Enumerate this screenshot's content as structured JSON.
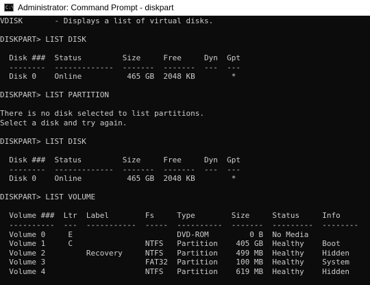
{
  "window": {
    "title": "Administrator: Command Prompt - diskpart",
    "icon_glyph": "C:\\"
  },
  "console": {
    "lines": [
      "VDISK       - Displays a list of virtual disks.",
      "",
      "DISKPART> LIST DISK",
      "",
      "  Disk ###  Status         Size     Free     Dyn  Gpt",
      "  --------  -------------  -------  -------  ---  ---",
      "  Disk 0    Online          465 GB  2048 KB        *",
      "",
      "DISKPART> LIST PARTITION",
      "",
      "There is no disk selected to list partitions.",
      "Select a disk and try again.",
      "",
      "DISKPART> LIST DISK",
      "",
      "  Disk ###  Status         Size     Free     Dyn  Gpt",
      "  --------  -------------  -------  -------  ---  ---",
      "  Disk 0    Online          465 GB  2048 KB        *",
      "",
      "DISKPART> LIST VOLUME",
      "",
      "  Volume ###  Ltr  Label        Fs     Type        Size     Status     Info",
      "  ----------  ---  -----------  -----  ----------  -------  ---------  --------",
      "  Volume 0     E                       DVD-ROM         0 B  No Media",
      "  Volume 1     C                NTFS   Partition    405 GB  Healthy    Boot",
      "  Volume 2         Recovery     NTFS   Partition    499 MB  Healthy    Hidden",
      "  Volume 3                      FAT32  Partition    100 MB  Healthy    System",
      "  Volume 4                      NTFS   Partition    619 MB  Healthy    Hidden"
    ]
  },
  "colors": {
    "console_bg": "#0c0c0c",
    "console_fg": "#cccccc",
    "titlebar_bg": "#ffffff"
  }
}
